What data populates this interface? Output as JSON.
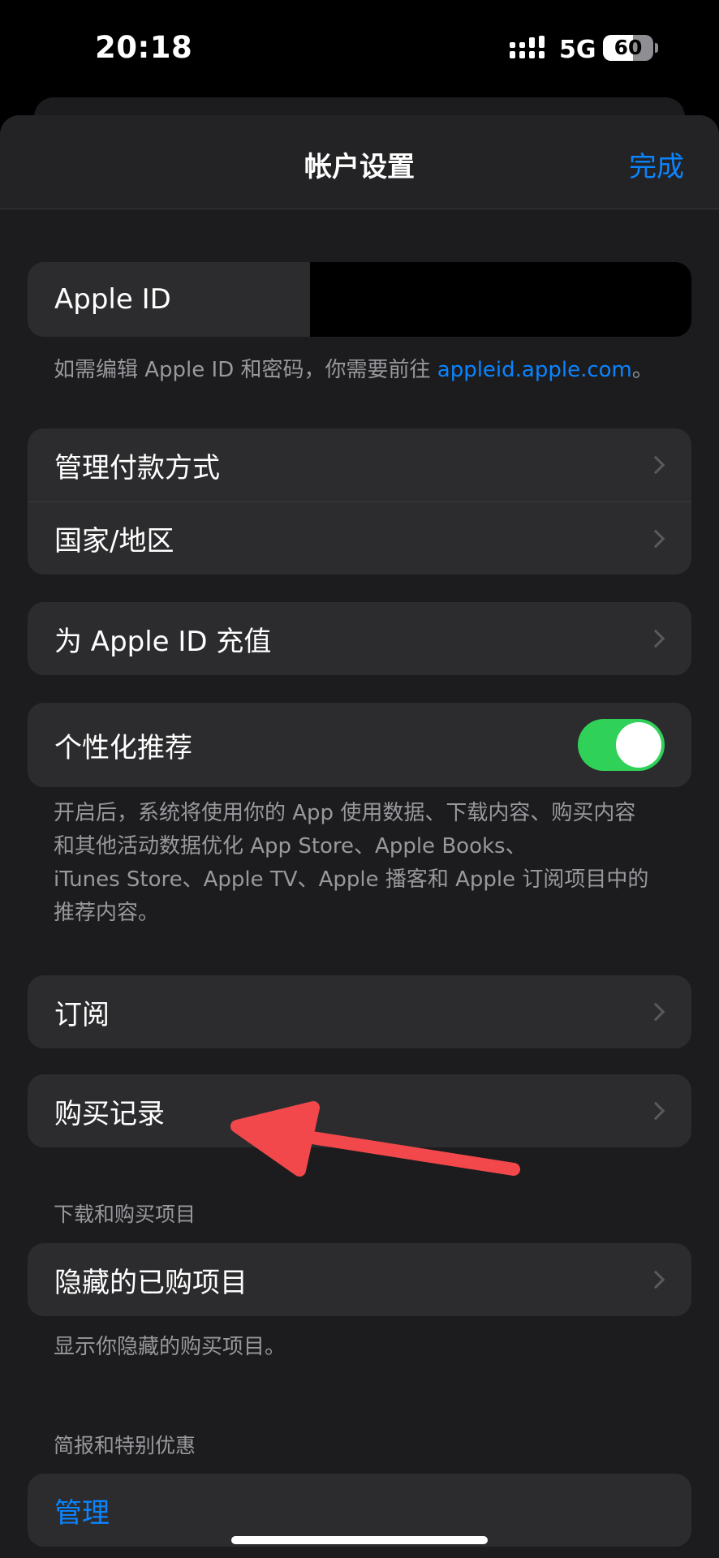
{
  "status": {
    "time": "20:18",
    "network": "5G",
    "battery_percent": 60,
    "battery_label": "60"
  },
  "nav": {
    "title": "帐户设置",
    "done_label": "完成"
  },
  "account": {
    "apple_id_label": "Apple ID",
    "note_prefix": "如需编辑 Apple ID 和密码，你需要前往 ",
    "note_link": "appleid.apple.com",
    "note_suffix": "。"
  },
  "payment_group": {
    "items": [
      {
        "label": "管理付款方式"
      },
      {
        "label": "国家/地区"
      }
    ]
  },
  "topup": {
    "label": "为 Apple ID 充值"
  },
  "personalization": {
    "label": "个性化推荐",
    "toggle_on": true,
    "note_lines": [
      "开启后，系统将使用你的 App 使用数据、下载内容、购买内容",
      "和其他活动数据优化 App Store、Apple Books、",
      "iTunes Store、Apple TV、Apple 播客和 Apple 订阅项目中的",
      "推荐内容。"
    ]
  },
  "subscriptions": {
    "label": "订阅"
  },
  "purchase_history": {
    "label": "购买记录"
  },
  "downloads": {
    "header": "下载和购买项目",
    "hidden_label": "隐藏的已购项目",
    "note": "显示你隐藏的购买项目。"
  },
  "newsletter": {
    "header": "简报和特别优惠",
    "manage_label": "管理"
  },
  "colors": {
    "accent": "#0a84ff",
    "toggle": "#30d158",
    "annotation_arrow": "#f2484b"
  }
}
